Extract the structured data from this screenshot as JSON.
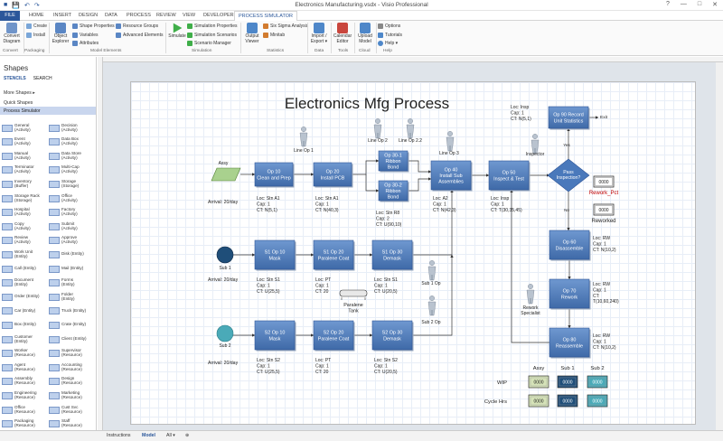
{
  "titlebar": {
    "title": "Electronics Manufacturing.vsdx - Visio Professional",
    "win_buttons": [
      "?",
      "—",
      "□",
      "✕"
    ]
  },
  "tabs": [
    "FILE",
    "HOME",
    "INSERT",
    "DESIGN",
    "DATA",
    "PROCESS",
    "REVIEW",
    "VIEW",
    "DEVELOPER",
    "PROCESS SIMULATOR"
  ],
  "active_tab": "PROCESS SIMULATOR",
  "ribbon": {
    "convert": {
      "label1": "Convert",
      "label2": "Diagram"
    },
    "create": "Create",
    "install": "Install",
    "object_explorer": {
      "label1": "Object",
      "label2": "Explorer"
    },
    "shape_properties": "Shape Properties",
    "variables": "Variables",
    "attributes": "Attributes",
    "resource_groups": "Resource Groups",
    "advanced_elements": "Advanced Elements",
    "simulate": "Simulate",
    "simulation_properties": "Simulation Properties",
    "simulation_scenarios": "Simulation Scenarios",
    "scenario_manager": "Scenario Manager",
    "output_viewer": {
      "label1": "Output",
      "label2": "Viewer"
    },
    "six_sigma": "Six Sigma Analysis",
    "minitab": "Minitab",
    "import_export": {
      "label1": "Import /",
      "label2": "Export ▾"
    },
    "calendar": {
      "label1": "Calendar",
      "label2": "Editor"
    },
    "upload": {
      "label1": "Upload",
      "label2": "Model"
    },
    "options": "Options",
    "tutorials": "Tutorials",
    "help": "Help ▾",
    "groups": [
      "Convert",
      "Packaging",
      "Model Elements",
      "Simulation",
      "Statistics",
      "Data",
      "Tools",
      "Cloud",
      "Help"
    ]
  },
  "shapes_pane": {
    "header": "Shapes",
    "tabs": [
      "STENCILS",
      "SEARCH"
    ],
    "more_shapes": "More Shapes  ▸",
    "quick_shapes": "Quick Shapes",
    "stencil": "Process Simulator",
    "items": [
      "General\n(Activity)",
      "Decision\n(Activity)",
      "Event\n(Activity)",
      "Data Box\n(Activity)",
      "Manual\n(Activity)",
      "Data Store\n(Activity)",
      "Terminator\n(Activity)",
      "Multi-Cap\n(Activity)",
      "Inventory\n(Buffer)",
      "Storage\n(Storage)",
      "Storage Rack\n(Storage)",
      "Office\n(Activity)",
      "Hospital\n(Activity)",
      "Factory\n(Activity)",
      "Copy\n(Activity)",
      "Submit\n(Activity)",
      "Review\n(Activity)",
      "Approve\n(Activity)",
      "Work Unit\n(Entity)",
      "Disk (Entity)",
      "Call (Entity)",
      "Mail (Entity)",
      "Document\n(Entity)",
      "Forms\n(Entity)",
      "Order (Entity)",
      "Folder\n(Entity)",
      "Car (Entity)",
      "Truck (Entity)",
      "Box (Entity)",
      "Crate (Entity)",
      "Customer\n(Entity)",
      "Client (Entity)",
      "Worker\n(Resource)",
      "Supervisor\n(Resource)",
      "Agent\n(Resource)",
      "Accounting\n(Resource)",
      "Assembly\n(Resource)",
      "Design\n(Resource)",
      "Engineering\n(Resource)",
      "Marketing\n(Resource)",
      "Office\n(Resource)",
      "Cust Svc\n(Resource)",
      "Packaging\n(Resource)",
      "Staff\n(Resource)"
    ]
  },
  "bottombar": {
    "pages": [
      "Instructions",
      "Model",
      "All ▾",
      "⊕"
    ],
    "active": "Model"
  },
  "diagram": {
    "title": "Electronics Mfg Process",
    "activities": [
      {
        "id": "op10",
        "label": "Op 10\nClean and Prep",
        "stats": [
          "Loc: Stn A1",
          "Cap: 1",
          "CT: N(5,1)"
        ]
      },
      {
        "id": "op20",
        "label": "Op 20\nInstall PCB",
        "stats": [
          "Loc: Stn A1",
          "Cap: 1",
          "CT: N(40,3)"
        ]
      },
      {
        "id": "op301",
        "label": "Op 30-1\nRibbon\nBond",
        "stats": []
      },
      {
        "id": "op302",
        "label": "Op 30-2\nRibbon\nBond",
        "stats": [
          "Loc: Stn R8",
          "Cap: 2",
          "CT: U(90,10)"
        ]
      },
      {
        "id": "op40",
        "label": "Op 40\nInstall Sub\nAssemblies",
        "stats": [
          "Loc: A2",
          "Cap: 1",
          "CT: N(42,3)"
        ]
      },
      {
        "id": "op50",
        "label": "Op 50\nInspect & Test",
        "stats": [
          "Loc: Insp",
          "Cap: 1",
          "CT: T(30,35,45)"
        ]
      },
      {
        "id": "op90",
        "label": "Op 90 Record\nUnit Statistics",
        "stats": [
          "Loc: Insp",
          "Cap: 1",
          "CT: N(5,1)"
        ]
      },
      {
        "id": "op60",
        "label": "Op 60\nDisassemble",
        "stats": [
          "Loc: RW",
          "Cap: 1",
          "CT: N(10,2)"
        ]
      },
      {
        "id": "op70",
        "label": "Op 70\nRework",
        "stats": [
          "Loc: RW",
          "Cap: 1",
          "CT:\nT(10,60,240)"
        ]
      },
      {
        "id": "op80",
        "label": "Op 80\nReassemble",
        "stats": [
          "Loc: RW",
          "Cap: 1",
          "CT: N(10,2)"
        ]
      },
      {
        "id": "s1op10",
        "label": "S1 Op 10\nMask",
        "stats": [
          "Loc: Stn S1",
          "Cap: 1",
          "CT: U(25,5)"
        ]
      },
      {
        "id": "s1op20",
        "label": "S1 Op 20\nParalene Coat",
        "stats": [
          "Loc: PT",
          "Cap: 1",
          "CT: 20"
        ]
      },
      {
        "id": "s1op30",
        "label": "S1 Op 30\nDemask",
        "stats": [
          "Loc: Stn S1",
          "Cap: 1",
          "CT: U(20,5)"
        ]
      },
      {
        "id": "s2op10",
        "label": "S2 Op 10\nMask",
        "stats": [
          "Loc: Stn S2",
          "Cap: 1",
          "CT: U(25,5)"
        ]
      },
      {
        "id": "s2op20",
        "label": "S2 Op 20\nParalene Coat",
        "stats": [
          "Loc: PT",
          "Cap: 1",
          "CT: 20"
        ]
      },
      {
        "id": "s2op30",
        "label": "S2 Op 30\nDemask",
        "stats": [
          "Loc: Stn S2",
          "Cap: 1",
          "CT: U(20,5)"
        ]
      }
    ],
    "decision": {
      "label": "Pass\nInspection?",
      "yes": "Yes",
      "no": "No"
    },
    "entities": [
      {
        "id": "assy",
        "label": "Assy",
        "arrival": "Arrival: 20/day"
      },
      {
        "id": "sub1",
        "label": "Sub 1",
        "arrival": "Arrival: 20/day"
      },
      {
        "id": "sub2",
        "label": "Sub 2",
        "arrival": "Arrival: 20/day"
      }
    ],
    "resources": [
      "Line Op 1",
      "Line Op 2",
      "Line Op 2.2",
      "Line Op 3",
      "Inspector",
      "Sub 1 Op",
      "Sub 2 Op",
      "Rework\nSpecialist"
    ],
    "tank": "Paralene\nTank",
    "exit_label": "Exit",
    "counters": [
      {
        "id": "rework_pct",
        "value": "0000",
        "label": "Rework_Pct"
      },
      {
        "id": "reworked",
        "value": "0000",
        "label": "Reworked"
      }
    ],
    "stats_table": {
      "columns": [
        "Assy",
        "Sub 1",
        "Sub 2"
      ],
      "rows": [
        {
          "label": "WIP",
          "values": [
            "0000",
            "0000",
            "0000"
          ]
        },
        {
          "label": "Cycle Hrs",
          "values": [
            "0000",
            "0000",
            "0000"
          ]
        }
      ]
    }
  },
  "colors": {
    "brand": "#2b579a",
    "activity_fill": "#4f7fbf",
    "decision_fill": "#4a79bb",
    "assy_fill": "#a9d18e",
    "sub1_fill": "#1f4e79",
    "sub2_fill": "#4aaab8",
    "rework_pct": "#c00000"
  }
}
